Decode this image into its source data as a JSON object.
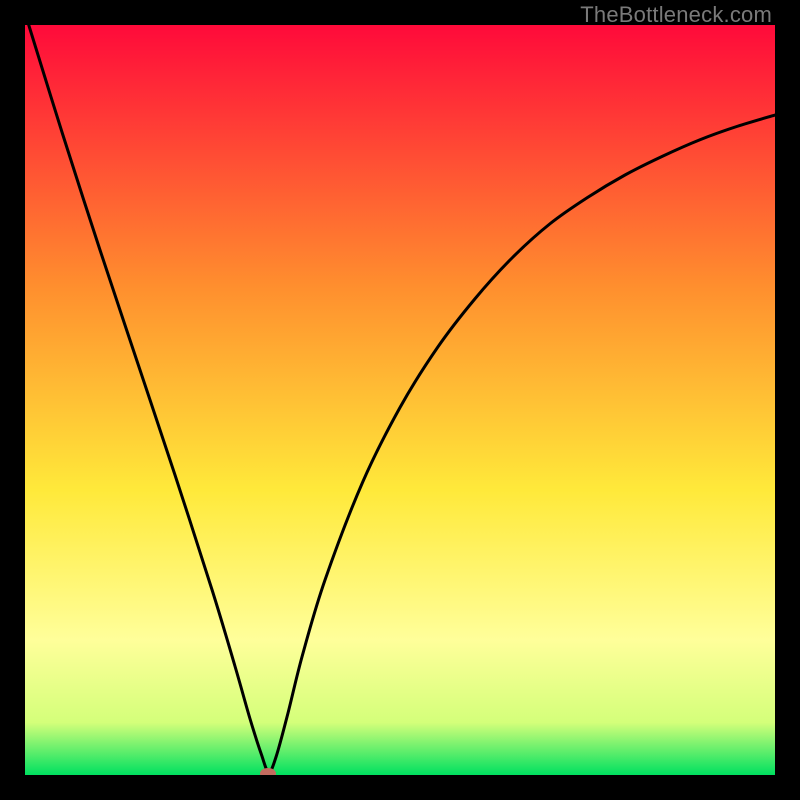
{
  "watermark": "TheBottleneck.com",
  "chart_data": {
    "type": "line",
    "title": "",
    "xlabel": "",
    "ylabel": "",
    "xlim": [
      0,
      100
    ],
    "ylim": [
      0,
      100
    ],
    "background_gradient": {
      "top_color": "#ff0a3a",
      "mid_color_upper": "#ff8f2e",
      "mid_color_lower": "#ffe93a",
      "soft_yellow": "#ffff9a",
      "near_bottom": "#d4ff7a",
      "bottom_color": "#00e060"
    },
    "series": [
      {
        "name": "bottleneck-curve",
        "color": "#000000",
        "x": [
          0.5,
          5,
          10,
          15,
          20,
          25,
          28,
          30,
          31.5,
          32.5,
          33.5,
          35,
          37,
          40,
          45,
          50,
          55,
          60,
          65,
          70,
          75,
          80,
          85,
          90,
          95,
          100
        ],
        "values": [
          100,
          85.5,
          70,
          55,
          40,
          24.5,
          14.5,
          7.5,
          2.8,
          0.4,
          2.5,
          8,
          16,
          26,
          39,
          49,
          57,
          63.5,
          69,
          73.5,
          77,
          80,
          82.5,
          84.7,
          86.5,
          88
        ]
      }
    ],
    "marker": {
      "name": "minimum-point",
      "x": 32.4,
      "y": 0.2,
      "color": "#c36b5f",
      "rx": 8,
      "ry": 5.5
    }
  }
}
